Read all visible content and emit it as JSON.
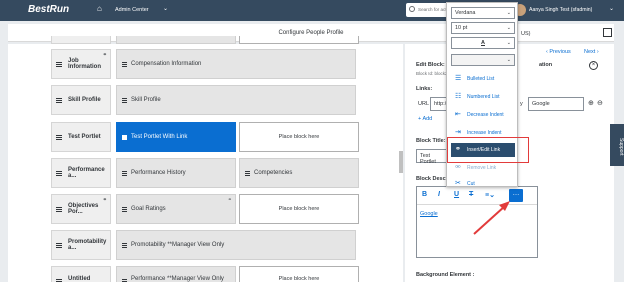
{
  "header": {
    "logo": "BestRun",
    "admin_center": "Admin Center",
    "search_placeholder": "Search for acti",
    "user_name": "Aanya Singh Test (sfadmin)"
  },
  "page_title": "Configure People Profile",
  "nav": {
    "prev": "Previous",
    "next": "Next"
  },
  "sections": [
    {
      "label": "Job Information",
      "blocks": [
        "Compensation Information"
      ]
    },
    {
      "label": "Skill Profile",
      "blocks": [
        "Skill Profile"
      ]
    },
    {
      "label": "Test Portlet",
      "blocks": [
        "Test Portlet With Link"
      ],
      "placeholder": "Place block here"
    },
    {
      "label": "Performance a...",
      "blocks": [
        "Performance History",
        "Competencies"
      ]
    },
    {
      "label": "Objectives Por...",
      "blocks": [
        "Goal Ratings"
      ],
      "placeholder": "Place block here"
    },
    {
      "label": "Promotability a...",
      "blocks": [
        "Promotability **Manager View Only"
      ]
    },
    {
      "label": "Untitled",
      "blocks": [
        "Performance **Manager View Only"
      ],
      "placeholder": "Place block here"
    }
  ],
  "right_panel": {
    "edit_block_label": "Edit Block: L",
    "block_id": "Block Id: block220",
    "links_label": "Links:",
    "url_label": "URL",
    "url_value": "http://",
    "link_text_label": "y",
    "link_text_value": "Google",
    "add_label": "Add",
    "block_title_label": "Block Title:",
    "block_title_value": "Test Portlet",
    "block_desc_label": "Block Descri",
    "editor_content": "Google",
    "background_label": "Background Element :",
    "lang_suffix": "US)",
    "description_suffix": "ation"
  },
  "dropdown": {
    "font": "Verdana",
    "size": "10 pt",
    "items": [
      {
        "label": "Bulleted List",
        "icon": "bulleted-list-icon"
      },
      {
        "label": "Numbered List",
        "icon": "numbered-list-icon"
      },
      {
        "label": "Decrease Indent",
        "icon": "decrease-indent-icon"
      },
      {
        "label": "Increase Indent",
        "icon": "increase-indent-icon"
      },
      {
        "label": "Insert/Edit Link",
        "icon": "link-icon"
      },
      {
        "label": "Remove Link",
        "icon": "unlink-icon"
      },
      {
        "label": "Cut",
        "icon": "cut-icon"
      }
    ]
  },
  "support_tab": "Support",
  "colors": {
    "shell": "#354a5f",
    "accent": "#0a6ed1",
    "highlight": "#e23b3b"
  }
}
